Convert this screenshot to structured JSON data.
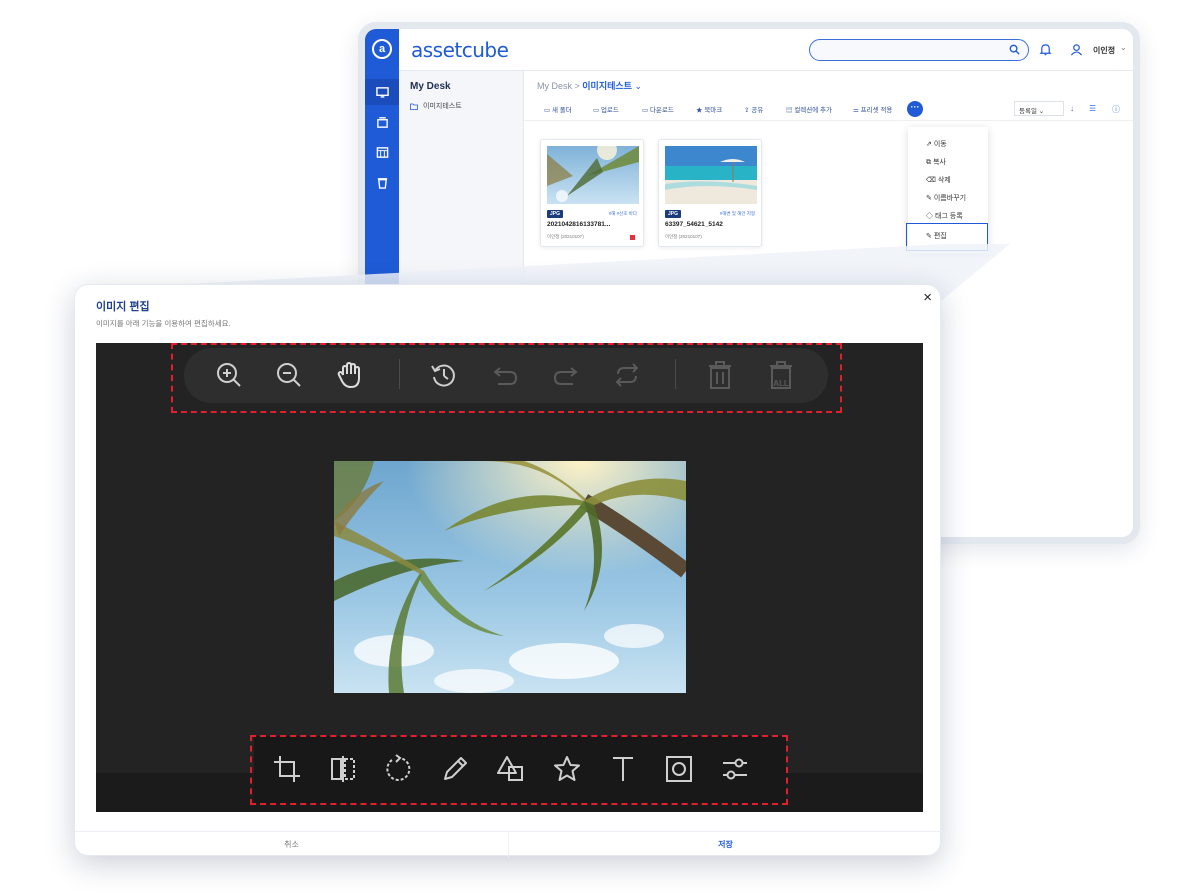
{
  "app": {
    "brand": "assetcube",
    "user_name": "이인정",
    "sidebar": {
      "title": "My Desk",
      "folder": "이미지테스트"
    },
    "breadcrumb": {
      "root": "My Desk >",
      "current": "이미지테스트"
    },
    "toolbar": {
      "new_folder": "새 폴더",
      "upload": "업로드",
      "download": "다운로드",
      "bookmark": "북마크",
      "share": "공유",
      "add_collection": "컬렉션에 추가",
      "apply_preset": "프리셋 적용",
      "more": "···",
      "sort": "등록일"
    },
    "cards": [
      {
        "type": "JPG",
        "tags": "#해 #산호 바다",
        "name": "20210428161337​81...",
        "meta": "이인정 (20210107)"
      },
      {
        "type": "JPG",
        "tags": "#해변 및 해안 지형",
        "name": "63397_54621_5142",
        "meta": "이인정 (20210107)"
      }
    ],
    "menu": {
      "move": "이동",
      "copy": "복사",
      "delete": "삭제",
      "rename": "이름바꾸기",
      "tag": "태그 등록",
      "edit": "편집"
    }
  },
  "modal": {
    "title": "이미지 편집",
    "subtitle": "이미지를 아래 기능을 이용하여 편집하세요.",
    "close": "×",
    "cancel": "취소",
    "save": "저장"
  },
  "icons": {
    "top_tools": [
      "zoom-in-icon",
      "zoom-out-icon",
      "hand-icon",
      "history-icon",
      "undo-icon",
      "redo-icon",
      "reset-icon",
      "delete-icon",
      "delete-all-icon"
    ],
    "bottom_tools": [
      "crop-icon",
      "flip-icon",
      "rotate-icon",
      "draw-icon",
      "shape-icon",
      "star-icon",
      "text-icon",
      "mask-icon",
      "filter-icon"
    ]
  },
  "colors": {
    "accent": "#1f5bd6",
    "highlight": "#e0202c",
    "editor_bg": "#232323"
  }
}
